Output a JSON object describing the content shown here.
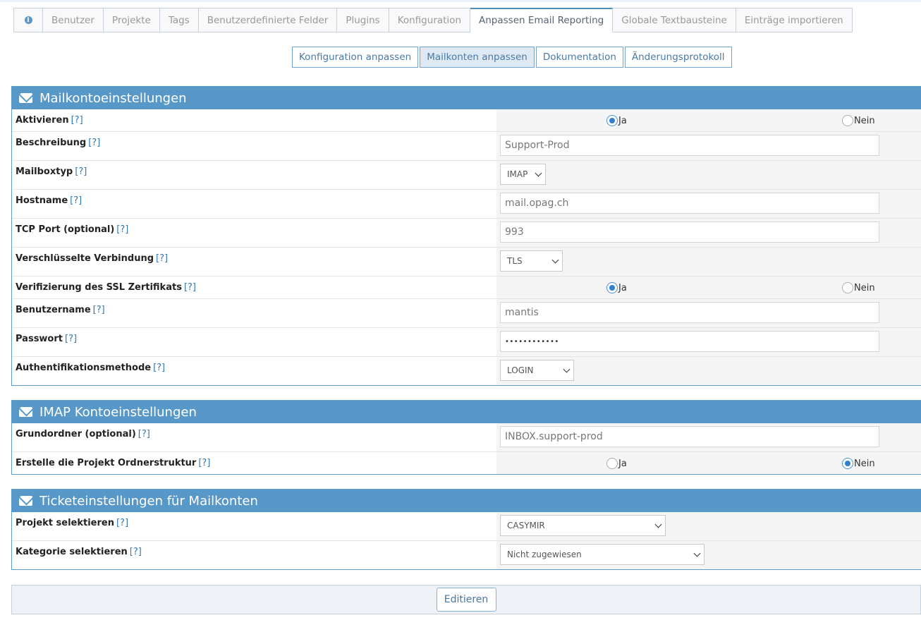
{
  "tabs": [
    {
      "label": ""
    },
    {
      "label": "Benutzer"
    },
    {
      "label": "Projekte"
    },
    {
      "label": "Tags"
    },
    {
      "label": "Benutzerdefinierte Felder"
    },
    {
      "label": "Plugins"
    },
    {
      "label": "Konfiguration"
    },
    {
      "label": "Anpassen Email Reporting"
    },
    {
      "label": "Globale Textbausteine"
    },
    {
      "label": "Einträge importieren"
    }
  ],
  "subnav": [
    "Konfiguration anpassen",
    "Mailkonten anpassen",
    "Dokumentation",
    "Änderungsprotokoll"
  ],
  "help": "[?]",
  "yes": "Ja",
  "no": "Nein",
  "mail": {
    "title": "Mailkontoeinstellungen",
    "aktivieren": "Aktivieren",
    "beschreibung": "Beschreibung",
    "beschreibung_val": "Support-Prod",
    "mailboxtyp": "Mailboxtyp",
    "mailboxtyp_val": "IMAP",
    "hostname": "Hostname",
    "hostname_val": "mail.opag.ch",
    "port": "TCP Port (optional)",
    "port_val": "993",
    "verschl": "Verschlüsselte Verbindung",
    "verschl_val": "TLS",
    "ssl": "Verifizierung des SSL Zertifikats",
    "user": "Benutzername",
    "user_val": "mantis",
    "pass": "Passwort",
    "pass_val": "••••••••••••",
    "auth": "Authentifikationsmethode",
    "auth_val": "LOGIN"
  },
  "imap": {
    "title": "IMAP Kontoeinstellungen",
    "grund": "Grundordner (optional)",
    "grund_val": "INBOX.support-prod",
    "struktur": "Erstelle die Projekt Ordnerstruktur"
  },
  "ticket": {
    "title": "Ticketeinstellungen für Mailkonten",
    "projekt": "Projekt selektieren",
    "projekt_val": "CASYMIR",
    "kategorie": "Kategorie selektieren",
    "kategorie_val": "Nicht zugewiesen"
  },
  "edit_label": "Editieren"
}
